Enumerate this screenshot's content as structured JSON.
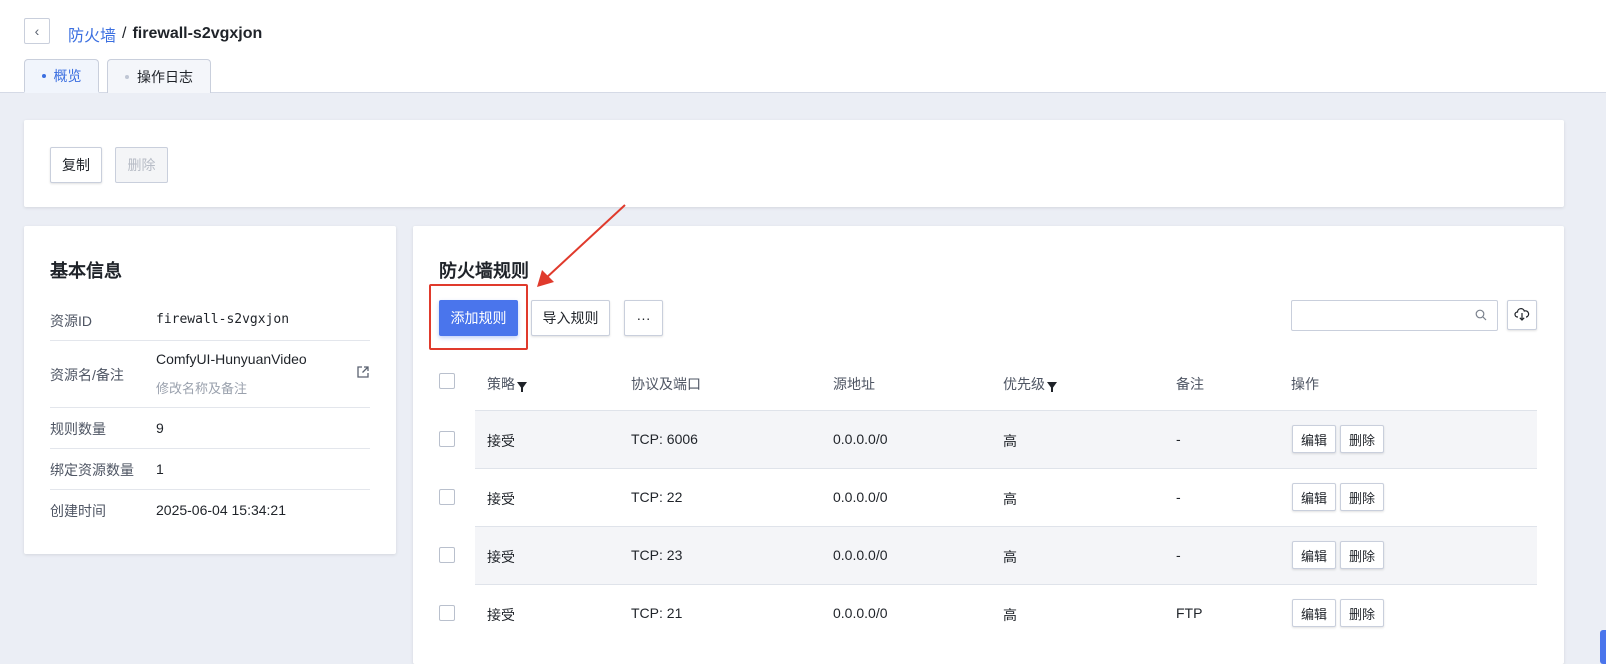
{
  "breadcrumb": {
    "parent": "防火墙",
    "separator": "/",
    "current": "firewall-s2vgxjon"
  },
  "tabs": [
    {
      "label": "概览",
      "active": true
    },
    {
      "label": "操作日志",
      "active": false
    }
  ],
  "toolbar": {
    "copy_label": "复制",
    "delete_label": "删除"
  },
  "basic_info": {
    "title": "基本信息",
    "rows": [
      {
        "key": "资源ID",
        "value": "firewall-s2vgxjon"
      },
      {
        "key": "资源名/备注",
        "value": "ComfyUI-HunyuanVideo",
        "sub": "修改名称及备注"
      },
      {
        "key": "规则数量",
        "value": "9"
      },
      {
        "key": "绑定资源数量",
        "value": "1"
      },
      {
        "key": "创建时间",
        "value": "2025-06-04 15:34:21"
      }
    ]
  },
  "rules": {
    "title": "防火墙规则",
    "add_label": "添加规则",
    "import_label": "导入规则",
    "more_label": "···",
    "search_placeholder": "",
    "columns": [
      "策略",
      "协议及端口",
      "源地址",
      "优先级",
      "备注",
      "操作"
    ],
    "rows": [
      {
        "policy": "接受",
        "port": "TCP: 6006",
        "source": "0.0.0.0/0",
        "priority": "高",
        "note": "-"
      },
      {
        "policy": "接受",
        "port": "TCP: 22",
        "source": "0.0.0.0/0",
        "priority": "高",
        "note": "-"
      },
      {
        "policy": "接受",
        "port": "TCP: 23",
        "source": "0.0.0.0/0",
        "priority": "高",
        "note": "-"
      },
      {
        "policy": "接受",
        "port": "TCP: 21",
        "source": "0.0.0.0/0",
        "priority": "高",
        "note": "FTP"
      }
    ],
    "edit_label": "编辑",
    "delete_label": "删除"
  },
  "colors": {
    "accent": "#4a75ec",
    "link": "#3b6fe0",
    "annotation": "#e03a2c"
  }
}
